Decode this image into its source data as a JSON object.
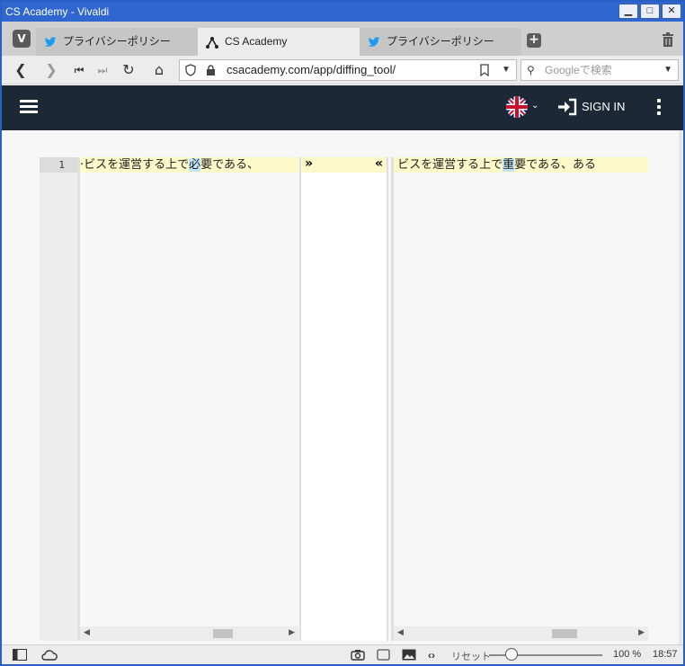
{
  "window": {
    "title": "CS Academy - Vivaldi"
  },
  "tabs": [
    {
      "label": "プライバシーポリシー",
      "icon": "twitter-icon",
      "active": false
    },
    {
      "label": "CS Academy",
      "icon": "csacademy-icon",
      "active": true
    },
    {
      "label": "プライバシーポリシー",
      "icon": "twitter-icon",
      "active": false
    }
  ],
  "address": {
    "url": "csacademy.com/app/diffing_tool/",
    "search_placeholder": "Googleで検索"
  },
  "header": {
    "signin_label": "SIGN IN"
  },
  "diff": {
    "line_number": "1",
    "left_text_before": "·ビスを運営する上で",
    "left_text_changed": "必",
    "left_text_after": "要である、",
    "right_text_before": "ビスを運営する上で",
    "right_text_changed": "重",
    "right_text_after": "要である、ある",
    "merge_right_glyph": "»",
    "merge_left_glyph": "«"
  },
  "status": {
    "reset_label": "リセット",
    "zoom": "100 %",
    "time": "18:57"
  },
  "colors": {
    "header_bg": "#1d2837",
    "added_line": "#fdf9c8",
    "changed_char": "#bfe3f7"
  }
}
